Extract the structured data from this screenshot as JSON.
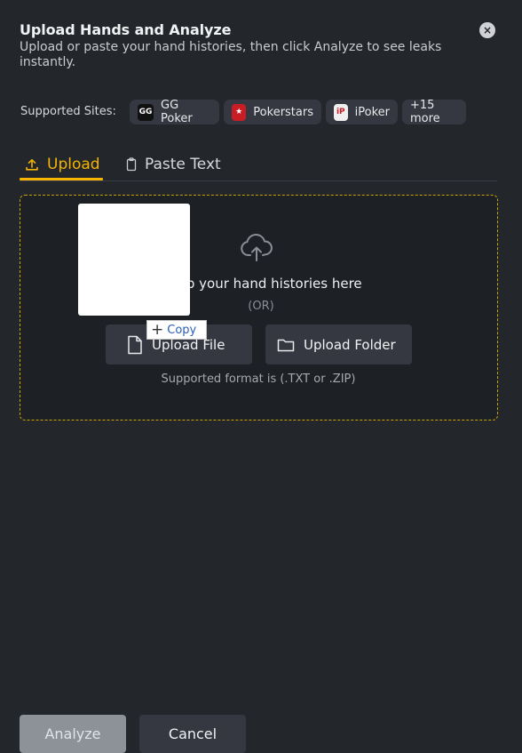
{
  "header": {
    "title": "Upload Hands and Analyze",
    "subtitle": "Upload or paste your hand histories, then click Analyze to see leaks instantly.",
    "close_symbol": "×"
  },
  "sites": {
    "label": "Supported Sites:",
    "items": [
      {
        "name": "GG Poker",
        "logo_text": "GG",
        "icon": "gg-poker-logo"
      },
      {
        "name": "Pokerstars",
        "logo_text": "★",
        "icon": "pokerstars-logo"
      },
      {
        "name": "iPoker",
        "logo_text": "iP",
        "icon": "ipoker-logo"
      }
    ],
    "more": "+15 more"
  },
  "tabs": [
    {
      "label": "Upload",
      "icon": "upload-icon",
      "active": true
    },
    {
      "label": "Paste Text",
      "icon": "clipboard-icon",
      "active": false
    }
  ],
  "dropzone": {
    "icon": "cloud-upload-icon",
    "text": "drop your hand histories here",
    "or": "(OR)",
    "upload_file": "Upload File",
    "upload_folder": "Upload Folder",
    "format": "Supported format is (.TXT or .ZIP)"
  },
  "overlay": {
    "copy_label": "Copy",
    "copy_symbol": "+"
  },
  "footer": {
    "analyze": "Analyze",
    "cancel": "Cancel"
  },
  "colors": {
    "background": "#23262b",
    "accent": "#f4b400",
    "chip": "#353840",
    "analyze_disabled": "#8d9198"
  }
}
